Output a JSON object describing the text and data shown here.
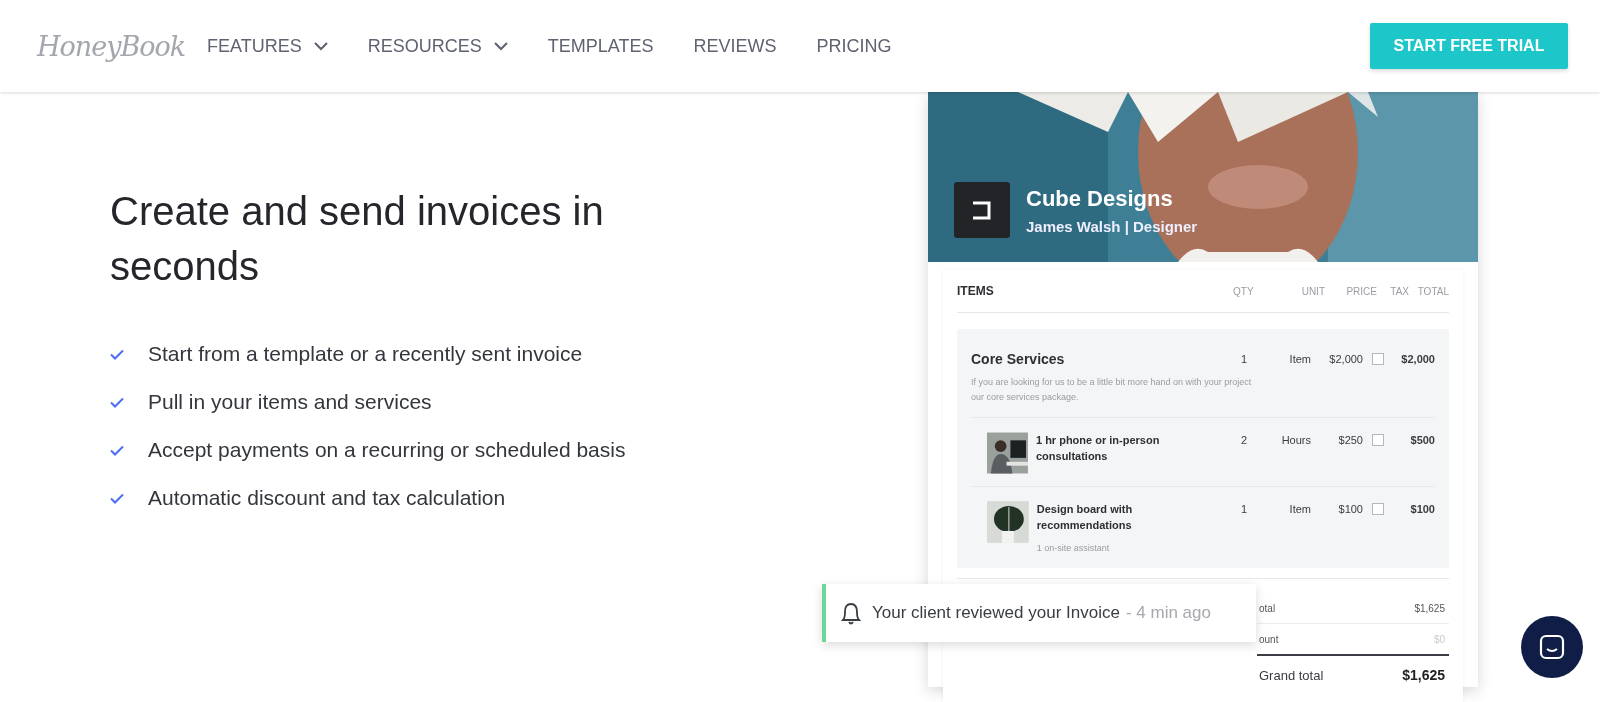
{
  "nav": {
    "logo": "HoneyBook",
    "items": [
      {
        "label": "FEATURES",
        "dropdown": true
      },
      {
        "label": "RESOURCES",
        "dropdown": true
      },
      {
        "label": "TEMPLATES",
        "dropdown": false
      },
      {
        "label": "REVIEWS",
        "dropdown": false
      },
      {
        "label": "PRICING",
        "dropdown": false
      }
    ],
    "cta": "START FREE TRIAL"
  },
  "hero": {
    "title": "Create and send invoices in seconds",
    "features": [
      "Start from a template or a recently sent invoice",
      "Pull in your items and services",
      "Accept payments on a recurring or scheduled basis",
      "Automatic discount and tax calculation"
    ]
  },
  "invoice": {
    "business": "Cube Designs",
    "contact": "James Walsh | Designer",
    "section_title": "ITEMS",
    "columns": [
      "QTY",
      "UNIT",
      "PRICE",
      "TAX",
      "TOTAL"
    ],
    "items": [
      {
        "kind": "group",
        "name": "Core Services",
        "description": "If you are looking for us to be a little bit more hand on with your project our core services package.",
        "qty": "1",
        "unit": "Item",
        "price": "$2,000",
        "tax_checked": false,
        "total": "$2,000"
      },
      {
        "kind": "subitem",
        "name": "1 hr phone or in-person consultations",
        "qty": "2",
        "unit": "Hours",
        "price": "$250",
        "tax_checked": false,
        "total": "$500"
      },
      {
        "kind": "subitem",
        "name": "Design board with recommendations",
        "description": "1 on-site assistant",
        "qty": "1",
        "unit": "Item",
        "price": "$100",
        "tax_checked": false,
        "total": "$100"
      }
    ],
    "totals": [
      {
        "kind": "plain",
        "label": "otal",
        "value": "$1,625"
      },
      {
        "kind": "faded",
        "label": "ount",
        "value": "$0"
      },
      {
        "kind": "grand",
        "label": "Grand total",
        "value": "$1,625"
      }
    ]
  },
  "notification": {
    "message": "Your client reviewed your Invoice",
    "time": "- 4 min ago"
  }
}
